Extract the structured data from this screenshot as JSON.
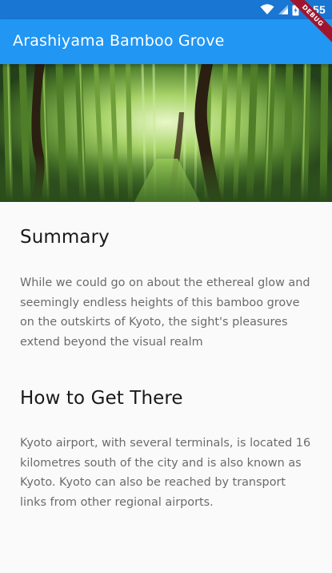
{
  "status_bar": {
    "time": "5:55",
    "icons": [
      "wifi-icon",
      "signal-icon",
      "battery-icon"
    ],
    "background_color": "#1976d2"
  },
  "app_bar": {
    "title": "Arashiyama Bamboo Grove",
    "background_color": "#2196f3"
  },
  "debug_banner": {
    "label": "DEBUG"
  },
  "hero": {
    "description_icon": "bamboo-forest-image"
  },
  "sections": [
    {
      "heading": "Summary",
      "body": "While we could go on about the ethereal glow and seemingly endless heights of this bamboo grove on the outskirts of Kyoto, the sight's pleasures extend beyond the visual realm"
    },
    {
      "heading": "How to Get There",
      "body": "Kyoto airport, with several terminals, is located 16 kilometres south of the city and is also known as Kyoto. Kyoto can also be reached by transport links from other regional airports."
    }
  ]
}
